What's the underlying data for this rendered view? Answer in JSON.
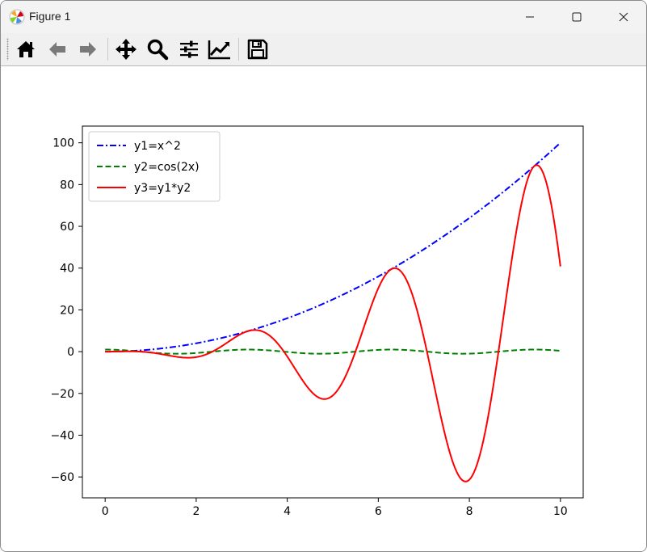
{
  "window": {
    "title": "Figure 1",
    "controls": {
      "minimize": "minimize",
      "maximize": "maximize",
      "close": "close"
    }
  },
  "toolbar": {
    "buttons": [
      {
        "name": "home",
        "icon": "home-icon"
      },
      {
        "name": "back",
        "icon": "arrow-left-icon"
      },
      {
        "name": "forward",
        "icon": "arrow-right-icon"
      },
      {
        "name": "pan",
        "icon": "move-icon"
      },
      {
        "name": "zoom",
        "icon": "magnifier-icon"
      },
      {
        "name": "configure-subplots",
        "icon": "sliders-icon"
      },
      {
        "name": "edit-axis",
        "icon": "line-chart-icon"
      },
      {
        "name": "save",
        "icon": "floppy-disk-icon"
      }
    ]
  },
  "chart_data": {
    "type": "line",
    "title": "",
    "xlabel": "",
    "ylabel": "",
    "xlim": [
      -0.5,
      10.5
    ],
    "ylim": [
      -70,
      108
    ],
    "xticks": [
      0,
      2,
      4,
      6,
      8,
      10
    ],
    "yticks": [
      -60,
      -40,
      -20,
      0,
      20,
      40,
      60,
      80,
      100
    ],
    "x_range": [
      0,
      10
    ],
    "grid": false,
    "legend_position": "upper-left",
    "series": [
      {
        "name": "y1=x^2",
        "expr": "x^2",
        "color": "#0000ff",
        "style": "dashdot"
      },
      {
        "name": "y2=cos(2x)",
        "expr": "cos(2x)",
        "color": "#008000",
        "style": "dashed"
      },
      {
        "name": "y3=y1*y2",
        "expr": "x^2*cos(2x)",
        "color": "#ff0000",
        "style": "solid"
      }
    ],
    "key_points": [
      {
        "x": 0,
        "y1": 0,
        "y2": 1,
        "y3": 0
      },
      {
        "x": 2,
        "y1": 4,
        "y2": -0.65,
        "y3": -2.6
      },
      {
        "x": 3.3,
        "y1": 10.9,
        "y2": 0.95,
        "y3": 10.4
      },
      {
        "x": 4.8,
        "y1": 23.0,
        "y2": -0.98,
        "y3": -22.5
      },
      {
        "x": 6.35,
        "y1": 40.3,
        "y2": 1.0,
        "y3": 40.0
      },
      {
        "x": 7.9,
        "y1": 62.4,
        "y2": -1.0,
        "y3": -62.3
      },
      {
        "x": 9.45,
        "y1": 89.3,
        "y2": 1.0,
        "y3": 89.0
      },
      {
        "x": 10,
        "y1": 100,
        "y2": 0.41,
        "y3": 40.8
      }
    ]
  }
}
